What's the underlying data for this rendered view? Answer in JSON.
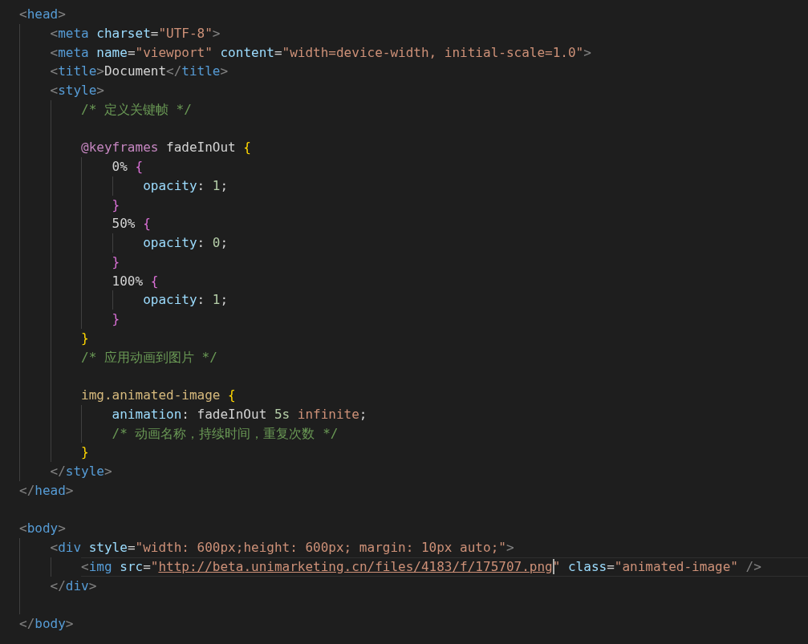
{
  "editor": {
    "lines": [
      {
        "kind": "code",
        "tokens": [
          {
            "kind": "punct",
            "text": "<"
          },
          {
            "kind": "tag",
            "text": "head"
          },
          {
            "kind": "punct",
            "text": ">"
          }
        ],
        "children": [
          {
            "kind": "code",
            "tokens": [
              {
                "kind": "punct",
                "text": "<"
              },
              {
                "kind": "tag",
                "text": "meta"
              },
              {
                "kind": "attr",
                "text": " charset"
              },
              {
                "kind": "op",
                "text": "="
              },
              {
                "kind": "str",
                "text": "\"UTF-8\""
              },
              {
                "kind": "punct",
                "text": ">"
              }
            ]
          },
          {
            "kind": "code",
            "tokens": [
              {
                "kind": "punct",
                "text": "<"
              },
              {
                "kind": "tag",
                "text": "meta"
              },
              {
                "kind": "attr",
                "text": " name"
              },
              {
                "kind": "op",
                "text": "="
              },
              {
                "kind": "str",
                "text": "\"viewport\""
              },
              {
                "kind": "attr",
                "text": " content"
              },
              {
                "kind": "op",
                "text": "="
              },
              {
                "kind": "str",
                "text": "\"width=device-width, initial-scale=1.0\""
              },
              {
                "kind": "punct",
                "text": ">"
              }
            ]
          },
          {
            "kind": "code",
            "tokens": [
              {
                "kind": "punct",
                "text": "<"
              },
              {
                "kind": "tag",
                "text": "title"
              },
              {
                "kind": "punct",
                "text": ">"
              },
              {
                "kind": "text",
                "text": "Document"
              },
              {
                "kind": "punct",
                "text": "</"
              },
              {
                "kind": "tag",
                "text": "title"
              },
              {
                "kind": "punct",
                "text": ">"
              }
            ]
          },
          {
            "kind": "code",
            "tokens": [
              {
                "kind": "punct",
                "text": "<"
              },
              {
                "kind": "tag",
                "text": "style"
              },
              {
                "kind": "punct",
                "text": ">"
              }
            ],
            "children": [
              {
                "kind": "code",
                "tokens": [
                  {
                    "kind": "comment",
                    "text": "/* 定义关键帧 */"
                  }
                ]
              },
              {
                "kind": "blank"
              },
              {
                "kind": "code",
                "tokens": [
                  {
                    "kind": "keyword",
                    "text": "@keyframes"
                  },
                  {
                    "kind": "text",
                    "text": " fadeInOut "
                  },
                  {
                    "kind": "brace1",
                    "text": "{"
                  }
                ],
                "children": [
                  {
                    "kind": "code",
                    "tokens": [
                      {
                        "kind": "text",
                        "text": "0% "
                      },
                      {
                        "kind": "brace2",
                        "text": "{"
                      }
                    ],
                    "children": [
                      {
                        "kind": "code",
                        "tokens": [
                          {
                            "kind": "prop",
                            "text": "opacity"
                          },
                          {
                            "kind": "text",
                            "text": ": "
                          },
                          {
                            "kind": "num",
                            "text": "1"
                          },
                          {
                            "kind": "text",
                            "text": ";"
                          }
                        ]
                      }
                    ]
                  },
                  {
                    "kind": "code",
                    "tokens": [
                      {
                        "kind": "brace2",
                        "text": "}"
                      }
                    ]
                  },
                  {
                    "kind": "code",
                    "tokens": [
                      {
                        "kind": "text",
                        "text": "50% "
                      },
                      {
                        "kind": "brace2",
                        "text": "{"
                      }
                    ],
                    "children": [
                      {
                        "kind": "code",
                        "tokens": [
                          {
                            "kind": "prop",
                            "text": "opacity"
                          },
                          {
                            "kind": "text",
                            "text": ": "
                          },
                          {
                            "kind": "num",
                            "text": "0"
                          },
                          {
                            "kind": "text",
                            "text": ";"
                          }
                        ]
                      }
                    ]
                  },
                  {
                    "kind": "code",
                    "tokens": [
                      {
                        "kind": "brace2",
                        "text": "}"
                      }
                    ]
                  },
                  {
                    "kind": "code",
                    "tokens": [
                      {
                        "kind": "text",
                        "text": "100% "
                      },
                      {
                        "kind": "brace2",
                        "text": "{"
                      }
                    ],
                    "children": [
                      {
                        "kind": "code",
                        "tokens": [
                          {
                            "kind": "prop",
                            "text": "opacity"
                          },
                          {
                            "kind": "text",
                            "text": ": "
                          },
                          {
                            "kind": "num",
                            "text": "1"
                          },
                          {
                            "kind": "text",
                            "text": ";"
                          }
                        ]
                      }
                    ]
                  },
                  {
                    "kind": "code",
                    "tokens": [
                      {
                        "kind": "brace2",
                        "text": "}"
                      }
                    ]
                  }
                ]
              },
              {
                "kind": "code",
                "tokens": [
                  {
                    "kind": "brace1",
                    "text": "}"
                  }
                ]
              },
              {
                "kind": "code",
                "tokens": [
                  {
                    "kind": "comment",
                    "text": "/* 应用动画到图片 */"
                  }
                ]
              },
              {
                "kind": "blank"
              },
              {
                "kind": "code",
                "tokens": [
                  {
                    "kind": "selector",
                    "text": "img.animated-image "
                  },
                  {
                    "kind": "brace1",
                    "text": "{"
                  }
                ],
                "children": [
                  {
                    "kind": "code",
                    "tokens": [
                      {
                        "kind": "prop",
                        "text": "animation"
                      },
                      {
                        "kind": "text",
                        "text": ": fadeInOut "
                      },
                      {
                        "kind": "num",
                        "text": "5s"
                      },
                      {
                        "kind": "value",
                        "text": " infinite"
                      },
                      {
                        "kind": "text",
                        "text": ";"
                      }
                    ]
                  },
                  {
                    "kind": "code",
                    "tokens": [
                      {
                        "kind": "comment",
                        "text": "/* 动画名称，持续时间，重复次数 */"
                      }
                    ]
                  }
                ]
              },
              {
                "kind": "code",
                "tokens": [
                  {
                    "kind": "brace1",
                    "text": "}"
                  }
                ]
              }
            ]
          },
          {
            "kind": "code",
            "tokens": [
              {
                "kind": "punct",
                "text": "</"
              },
              {
                "kind": "tag",
                "text": "style"
              },
              {
                "kind": "punct",
                "text": ">"
              }
            ]
          }
        ]
      },
      {
        "kind": "code",
        "tokens": [
          {
            "kind": "punct",
            "text": "</"
          },
          {
            "kind": "tag",
            "text": "head"
          },
          {
            "kind": "punct",
            "text": ">"
          }
        ]
      },
      {
        "kind": "blank"
      },
      {
        "kind": "code",
        "tokens": [
          {
            "kind": "punct",
            "text": "<"
          },
          {
            "kind": "tag",
            "text": "body"
          },
          {
            "kind": "punct",
            "text": ">"
          }
        ],
        "children": [
          {
            "kind": "code",
            "tokens": [
              {
                "kind": "punct",
                "text": "<"
              },
              {
                "kind": "tag",
                "text": "div"
              },
              {
                "kind": "attr",
                "text": " style"
              },
              {
                "kind": "op",
                "text": "="
              },
              {
                "kind": "str",
                "text": "\"width: 600px;height: 600px; margin: 10px auto;\""
              },
              {
                "kind": "punct",
                "text": ">"
              }
            ],
            "children": [
              {
                "kind": "code",
                "current": true,
                "tokens": [
                  {
                    "kind": "punct",
                    "text": "<"
                  },
                  {
                    "kind": "tag",
                    "text": "img"
                  },
                  {
                    "kind": "attr",
                    "text": " src"
                  },
                  {
                    "kind": "op",
                    "text": "="
                  },
                  {
                    "kind": "str",
                    "text": "\""
                  },
                  {
                    "kind": "link",
                    "text": "http://beta.unimarketing.cn/files/4183/f/175707.png",
                    "cursor": true
                  },
                  {
                    "kind": "str",
                    "text": "\""
                  },
                  {
                    "kind": "attr",
                    "text": " class"
                  },
                  {
                    "kind": "op",
                    "text": "="
                  },
                  {
                    "kind": "str",
                    "text": "\"animated-image\""
                  },
                  {
                    "kind": "punct",
                    "text": " />"
                  }
                ]
              }
            ]
          },
          {
            "kind": "code",
            "tokens": [
              {
                "kind": "punct",
                "text": "</"
              },
              {
                "kind": "tag",
                "text": "div"
              },
              {
                "kind": "punct",
                "text": ">"
              }
            ]
          },
          {
            "kind": "blank"
          }
        ]
      },
      {
        "kind": "code",
        "tokens": [
          {
            "kind": "punct",
            "text": "</"
          },
          {
            "kind": "tag",
            "text": "body"
          },
          {
            "kind": "punct",
            "text": ">"
          }
        ]
      }
    ]
  }
}
